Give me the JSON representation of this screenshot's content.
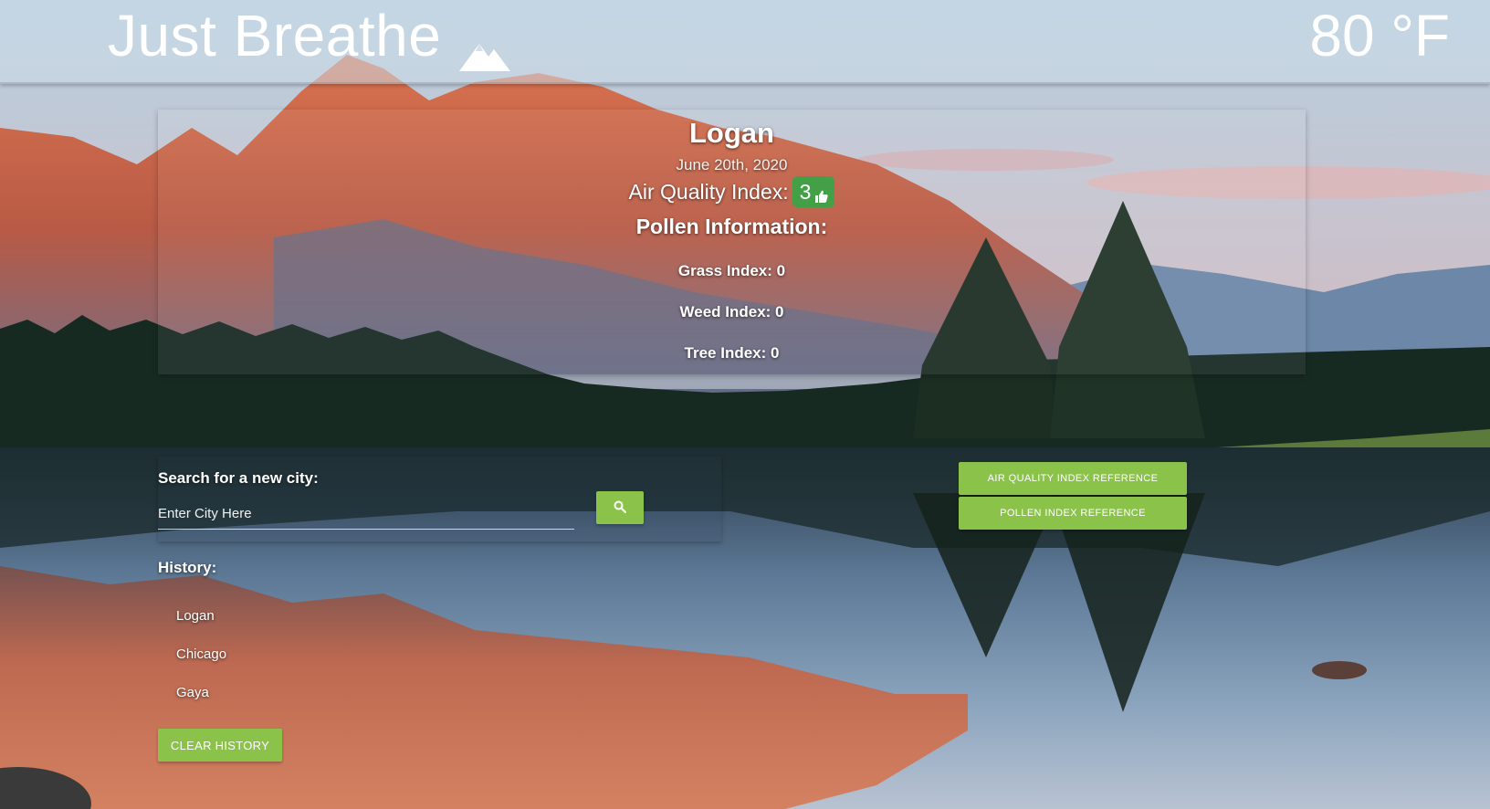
{
  "header": {
    "brand_title": "Just Breathe",
    "brand_icon": "mountain-icon",
    "temperature": "80 °F"
  },
  "weather": {
    "city": "Logan",
    "date": "June 20th, 2020",
    "aqi_label": "Air Quality Index:",
    "aqi_value": "3",
    "aqi_icon": "thumbs-up-icon",
    "aqi_badge_color": "#43a047",
    "pollen_title": "Pollen Information:",
    "grass": "Grass Index: 0",
    "weed": "Weed Index: 0",
    "tree": "Tree Index: 0"
  },
  "search": {
    "label": "Search for a new city:",
    "placeholder": "Enter City Here",
    "button_icon": "search-icon"
  },
  "references": {
    "aqi_button": "AIR QUALITY INDEX REFERENCE",
    "pollen_button": "POLLEN INDEX REFERENCE"
  },
  "history": {
    "title": "History:",
    "items": [
      "Logan",
      "Chicago",
      "Gaya"
    ],
    "clear_label": "CLEAR HISTORY"
  },
  "colors": {
    "accent": "#8bc34a",
    "text": "#ffffff"
  }
}
